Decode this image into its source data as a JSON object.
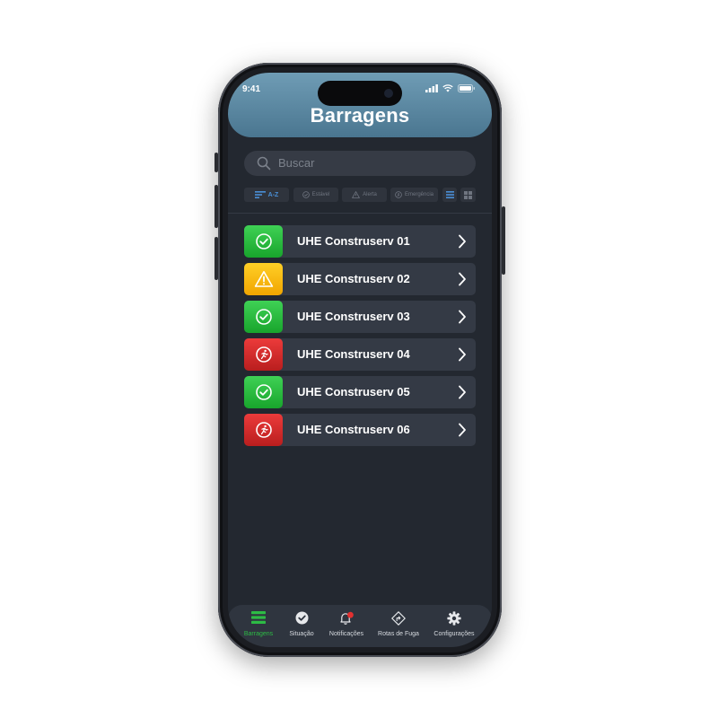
{
  "status_bar": {
    "time": "9:41"
  },
  "header": {
    "title": "Barragens"
  },
  "search": {
    "placeholder": "Buscar"
  },
  "filters": {
    "sort_label": "A-Z",
    "stable_label": "Estável",
    "alert_label": "Alerta",
    "emergency_label": "Emergência"
  },
  "list": {
    "items": [
      {
        "label": "UHE Construserv 01",
        "status": "stable"
      },
      {
        "label": "UHE Construserv 02",
        "status": "alert"
      },
      {
        "label": "UHE Construserv 03",
        "status": "stable"
      },
      {
        "label": "UHE Construserv 04",
        "status": "emergency"
      },
      {
        "label": "UHE Construserv 05",
        "status": "stable"
      },
      {
        "label": "UHE Construserv 06",
        "status": "emergency"
      }
    ]
  },
  "tabbar": {
    "tabs": [
      {
        "label": "Barragens",
        "icon": "dam-list-icon",
        "active": true
      },
      {
        "label": "Situação",
        "icon": "check-circle-icon",
        "active": false
      },
      {
        "label": "Notificações",
        "icon": "bell-icon",
        "active": false
      },
      {
        "label": "Rotas de Fuga",
        "icon": "route-sign-icon",
        "active": false
      },
      {
        "label": "Configurações",
        "icon": "gear-icon",
        "active": false
      }
    ]
  },
  "colors": {
    "header": "#5b8aa4",
    "background": "#232830",
    "row": "#343a45",
    "stable": "#22b838",
    "alert": "#fbbd12",
    "emergency": "#d52c2c",
    "accent_active": "#2dbb45",
    "accent_blue": "#4a8fd6"
  }
}
